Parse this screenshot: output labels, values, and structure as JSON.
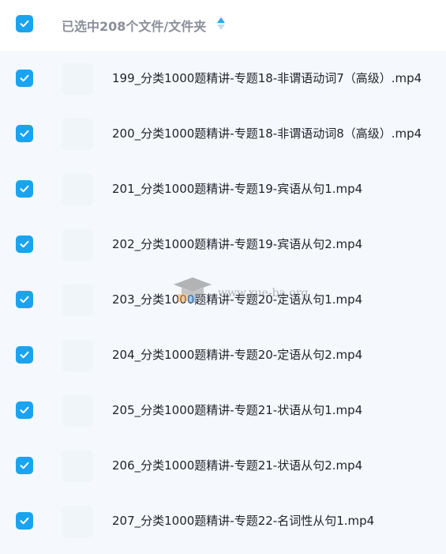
{
  "header": {
    "title": "已选中208个文件/文件夹",
    "all_checked": true
  },
  "files": [
    {
      "name": "199_分类1000题精讲-专题18-非谓语动词7（高级）.mp4",
      "checked": true
    },
    {
      "name": "200_分类1000题精讲-专题18-非谓语动词8（高级）.mp4",
      "checked": true
    },
    {
      "name": "201_分类1000题精讲-专题19-宾语从句1.mp4",
      "checked": true
    },
    {
      "name": "202_分类1000题精讲-专题19-宾语从句2.mp4",
      "checked": true
    },
    {
      "name": "203_分类1000题精讲-专题20-定语从句1.mp4",
      "checked": true
    },
    {
      "name": "204_分类1000题精讲-专题20-定语从句2.mp4",
      "checked": true
    },
    {
      "name": "205_分类1000题精讲-专题21-状语从句1.mp4",
      "checked": true
    },
    {
      "name": "206_分类1000题精讲-专题21-状语从句2.mp4",
      "checked": true
    },
    {
      "name": "207_分类1000题精讲-专题22-名词性从句1.mp4",
      "checked": true
    }
  ],
  "watermark": {
    "text": "www.xue-ba.org"
  },
  "colors": {
    "accent": "#1aa4f0",
    "list_background": "#f5f9fd",
    "header_text": "#8b8f99",
    "file_text": "#1f2329"
  }
}
